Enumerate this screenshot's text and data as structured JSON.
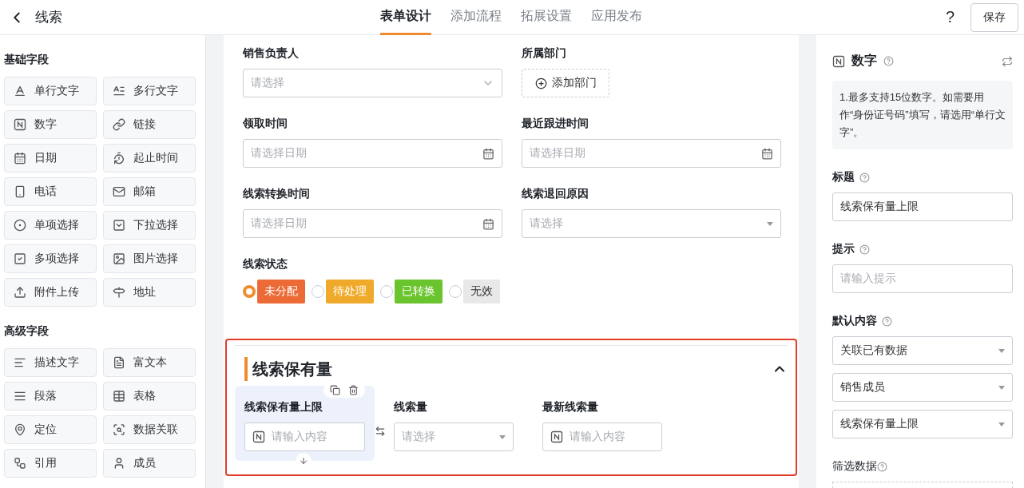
{
  "header": {
    "title": "线索",
    "tabs": [
      {
        "label": "表单设计",
        "selected": true
      },
      {
        "label": "添加流程",
        "selected": false
      },
      {
        "label": "拓展设置",
        "selected": false
      },
      {
        "label": "应用发布",
        "selected": false
      }
    ],
    "help": "?",
    "save": "保存"
  },
  "sidebar": {
    "groups": [
      {
        "title": "基础字段",
        "items": [
          "单行文字",
          "多行文字",
          "数字",
          "链接",
          "日期",
          "起止时间",
          "电话",
          "邮箱",
          "单项选择",
          "下拉选择",
          "多项选择",
          "图片选择",
          "附件上传",
          "地址"
        ]
      },
      {
        "title": "高级字段",
        "items": [
          "描述文字",
          "富文本",
          "段落",
          "表格",
          "定位",
          "数据关联",
          "引用",
          "成员"
        ]
      }
    ]
  },
  "form": {
    "fields": [
      {
        "label": "销售负责人",
        "kind": "select",
        "placeholder": "请选择"
      },
      {
        "label": "所属部门",
        "kind": "add",
        "button": "添加部门"
      },
      {
        "label": "领取时间",
        "kind": "date",
        "placeholder": "请选择日期"
      },
      {
        "label": "最近跟进时间",
        "kind": "date",
        "placeholder": "请选择日期"
      },
      {
        "label": "线索转换时间",
        "kind": "date",
        "placeholder": "请选择日期"
      },
      {
        "label": "线索退回原因",
        "kind": "dropdown",
        "placeholder": "请选择"
      }
    ],
    "status": {
      "label": "线索状态",
      "options": [
        {
          "label": "未分配",
          "color": "#ec6a35",
          "selected": true
        },
        {
          "label": "待处理",
          "color": "#f0aa2b",
          "selected": false
        },
        {
          "label": "已转换",
          "color": "#6ac42d",
          "selected": false
        },
        {
          "label": "无效",
          "color": "#e8e8e8",
          "selected": false
        }
      ]
    },
    "section": {
      "title": "线索保有量",
      "expanded": true,
      "fields": [
        {
          "label": "线索保有量上限",
          "kind": "number",
          "placeholder": "请输入内容",
          "selected": true
        },
        {
          "label": "线索量",
          "kind": "dropdown",
          "placeholder": "请选择",
          "selected": false
        },
        {
          "label": "最新线索量",
          "kind": "number",
          "placeholder": "请输入内容",
          "selected": false
        }
      ]
    }
  },
  "panel": {
    "type": "数字",
    "note": "1.最多支持15位数字。如需要用作“身份证号码”填写，请选用“单行文字”。",
    "title_label": "标题",
    "title_value": "线索保有量上限",
    "hint_label": "提示",
    "hint_placeholder": "请输入提示",
    "default_label": "默认内容",
    "default_values": [
      "关联已有数据",
      "销售成员",
      "线索保有量上限"
    ],
    "filter_label": "筛选数据"
  }
}
